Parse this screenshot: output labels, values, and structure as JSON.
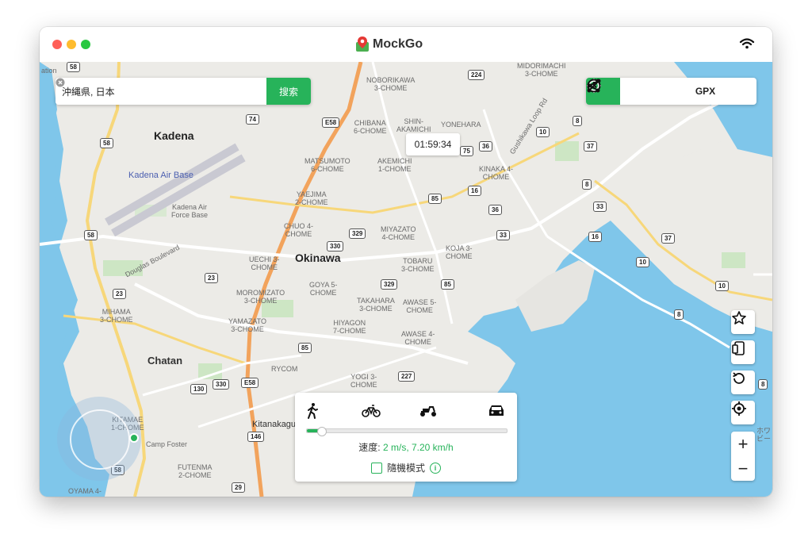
{
  "app": {
    "title": "MockGo"
  },
  "search": {
    "value": "沖縄県, 日本",
    "button_label": "搜索"
  },
  "toolbar": {
    "items": [
      "teleport-mode",
      "two-spot-route",
      "multi-spot-route",
      "GPX",
      "history"
    ],
    "gpx_label": "GPX",
    "active": "teleport-mode"
  },
  "timer": {
    "text": "01:59:34"
  },
  "speed_panel": {
    "modes": [
      "walk-icon",
      "bike-icon",
      "scooter-icon",
      "car-icon"
    ],
    "speed_label": "速度:",
    "speed_value": "2 m/s, 7.20 km/h",
    "slider_fraction": 0.06,
    "random_mode_label": "隨機模式"
  },
  "side_controls": [
    "favorite-star",
    "device-switch",
    "reset-location",
    "my-location",
    "zoom-in",
    "zoom-out"
  ],
  "zoom": {
    "in_label": "+",
    "out_label": "−"
  },
  "map": {
    "places": {
      "kadena": "Kadena",
      "kadena_air_base": "Kadena Air Base",
      "kadena_air_force_base": "Kadena Air\nForce Base",
      "okinawa": "Okinawa",
      "chatan": "Chatan",
      "kitanakagusuku": "Kitanakagu",
      "camp_foster": "Camp Foster",
      "douglas_boulevard": "Douglas Boulevard",
      "gushikawa_loop": "Gushikawa Loop Rd",
      "rycom": "RYCOM",
      "ation": "ation"
    },
    "districts": [
      "NOBORIKAWA\n3-CHOME",
      "CHIBANA\n6-CHOME",
      "SHIN-\nAKAMICHI",
      "YONEHARA",
      "MIDORIMACHI\n3-CHOME",
      "MATSUMOTO\n6-CHOME",
      "AKEMICHI\n1-CHOME",
      "KINAKA 4-\nCHOME",
      "YAEJIMA\n2-CHOME",
      "CHUO 4-\nCHOME",
      "MIYAZATO\n4-CHOME",
      "KOJA 3-\nCHOME",
      "UECHI 3-\nCHOME",
      "TOBARU\n3-CHOME",
      "GOYA 5-\nCHOME",
      "MOROMIZATO\n3-CHOME",
      "TAKAHARA\n3-CHOME",
      "AWASE 5-\nCHOME",
      "MIHAMA\n3-CHOME",
      "YAMAZATO\n3-CHOME",
      "HIYAGON\n7-CHOME",
      "AWASE 4-\nCHOME",
      "YOGI 3-\nCHOME",
      "KITAMAE\n1-CHOME",
      "FUTENMA\n2-CHOME",
      "OYAMA 4-",
      "ホワ\nビー"
    ],
    "shields": [
      "58",
      "224",
      "74",
      "E58",
      "8",
      "75",
      "36",
      "10",
      "37",
      "58",
      "85",
      "16",
      "8",
      "36",
      "33",
      "329",
      "330",
      "33",
      "16",
      "37",
      "58",
      "23",
      "23",
      "10",
      "85",
      "329",
      "10",
      "8",
      "85",
      "227",
      "130",
      "330",
      "E58",
      "146",
      "58",
      "29",
      "8"
    ]
  }
}
